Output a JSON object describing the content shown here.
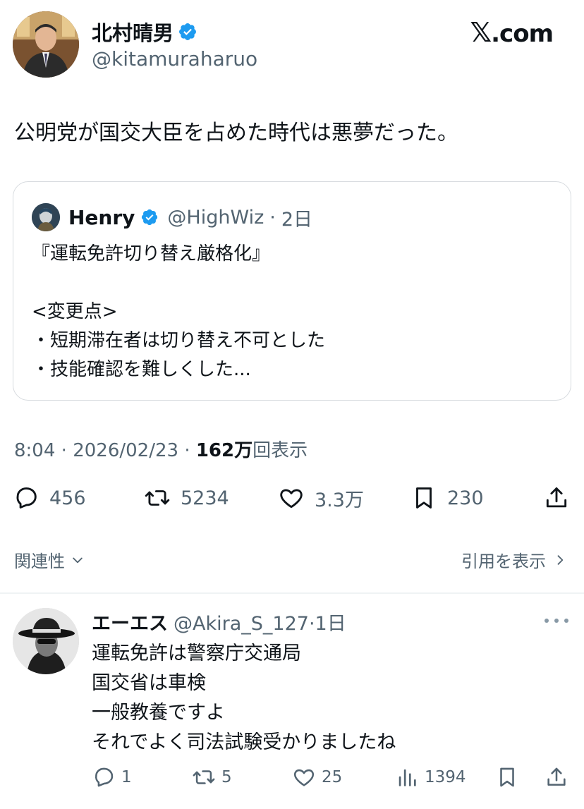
{
  "author": {
    "name": "北村晴男",
    "handle": "@kitamuraharuo"
  },
  "brand": {
    "mark": "𝕏",
    "suffix": ".com"
  },
  "tweet": {
    "text": "公明党が国交大臣を占めた時代は悪夢だった。",
    "time": "8:04",
    "date": "2026/02/23",
    "views_count": "162万",
    "views_label": "回表示",
    "sep": "·"
  },
  "quote": {
    "name": "Henry",
    "handle": "@HighWiz",
    "age": "2日",
    "sep": "·",
    "body": "『運転免許切り替え厳格化』\n\n<変更点>\n・短期滞在者は切り替え不可とした\n・技能確認を難しくした..."
  },
  "actions": {
    "replies": "456",
    "reposts": "5234",
    "likes": "3.3万",
    "bookmarks": "230"
  },
  "sort": {
    "label": "関連性",
    "quotes_link": "引用を表示"
  },
  "reply": {
    "name": "エーエス",
    "handle": "@Akira_S_127",
    "age": "1日",
    "sep": "·",
    "lines": [
      "運転免許は警察庁交通局",
      "国交省は車検",
      "一般教養ですよ",
      "それでよく司法試験受かりましたね"
    ],
    "replies": "1",
    "reposts": "5",
    "likes": "25",
    "views": "1394"
  },
  "colors": {
    "verified": "#1d9bf0",
    "text": "#0f1419",
    "secondary": "#536471",
    "border": "#d7dbdf"
  }
}
